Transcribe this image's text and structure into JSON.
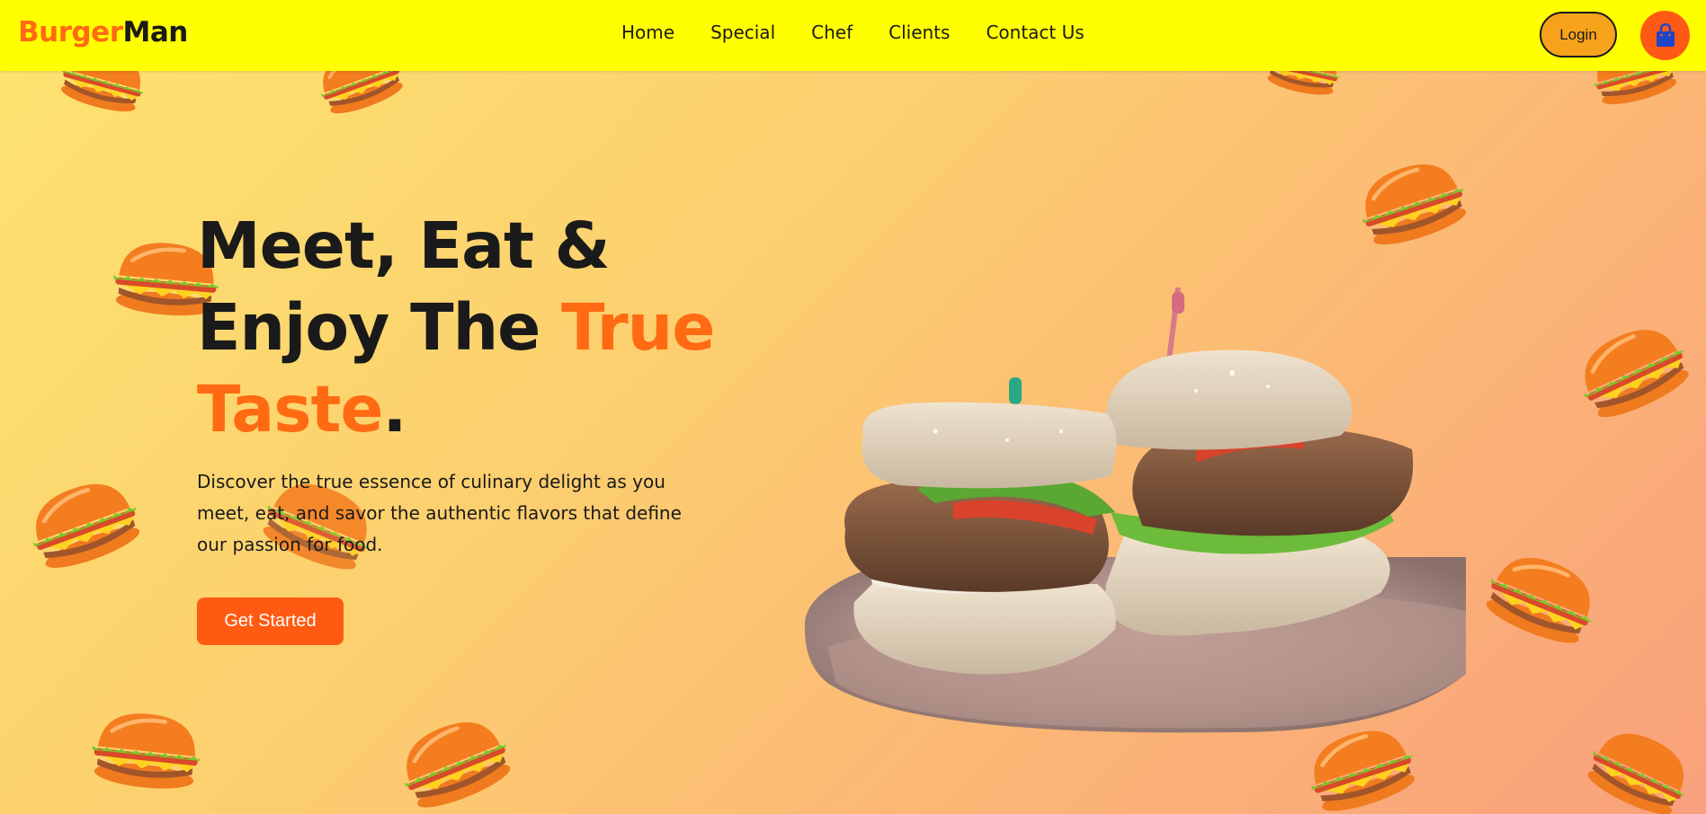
{
  "brand": {
    "part1": "Burger",
    "part2": "Man",
    "accent_color": "#ff6a13"
  },
  "nav": {
    "items": [
      "Home",
      "Special",
      "Chef",
      "Clients",
      "Contact Us"
    ],
    "background": "#ffff00"
  },
  "actions": {
    "login_label": "Login",
    "cart_icon": "shopping-bag-icon"
  },
  "hero": {
    "line1": "Meet, Eat &",
    "line2_prefix": "Enjoy The ",
    "line2_highlight": "True",
    "line3_highlight": "Taste",
    "line3_suffix": ".",
    "description": "Discover the true essence of culinary delight as you meet, eat, and savor the authentic flavors that define our passion for food.",
    "cta_label": "Get Started",
    "image_icon": "burger-plate-image"
  },
  "colors": {
    "cta": "#ff5a12",
    "cart": "#ff5a14",
    "login": "#f7a21b",
    "cart_bag": "#1e46c8"
  }
}
